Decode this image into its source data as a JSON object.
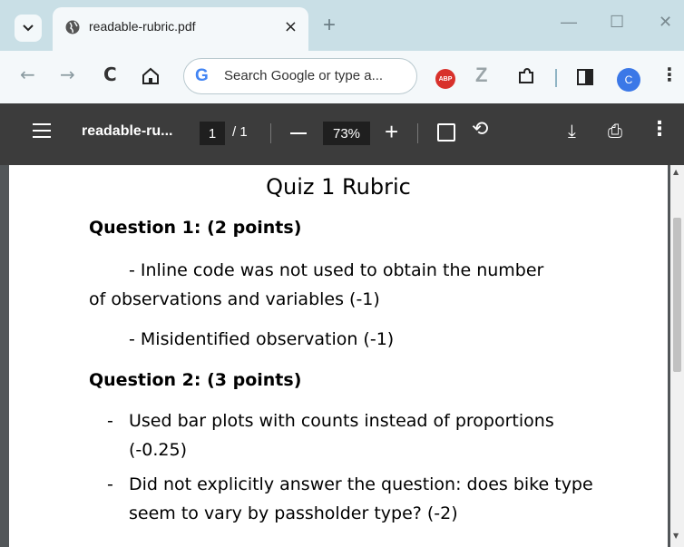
{
  "browser": {
    "tab_title": "readable-rubric.pdf",
    "tab_close": "×",
    "new_tab": "+",
    "window_minimize": "—",
    "window_maximize": "☐",
    "window_close": "✕",
    "omnibox_logo": "G",
    "omnibox_placeholder": "Search Google or type a...",
    "abp_label": "ABP",
    "z_label": "Z",
    "avatar_initial": "C"
  },
  "pdf_toolbar": {
    "title": "readable-ru...",
    "current_page": "1",
    "total_pages": "/  1",
    "zoom": "73%"
  },
  "document": {
    "title": "Quiz 1 Rubric",
    "q1_heading": "Question 1: (2 points)",
    "q1_item1_line1": "- Inline code was not used to obtain the number",
    "q1_item1_line2": "of observations and variables (-1)",
    "q1_item2": "- Misidentified observation (-1)",
    "q2_heading": "Question 2: (3 points)",
    "q2_bullets": [
      {
        "dash": "-",
        "text": "Used bar plots with counts instead of proportions (-0.25)"
      },
      {
        "dash": "-",
        "text": "Did not explicitly answer the question: does bike type seem to vary by passholder type? (-2)"
      }
    ]
  },
  "colors": {
    "titlebar": "#c9dfe6",
    "toolbar": "#f4f8fa",
    "pdf_toolbar": "#3c3c3c",
    "viewer_bg": "#525659"
  }
}
